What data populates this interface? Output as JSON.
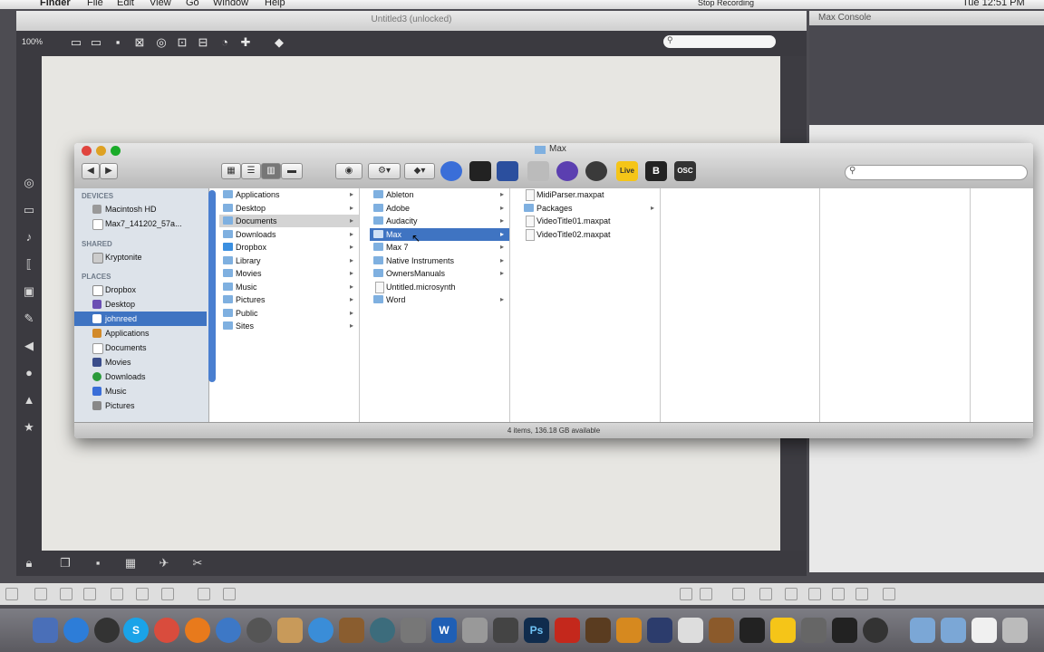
{
  "menubar": {
    "app_name": "Finder",
    "items": [
      "File",
      "Edit",
      "View",
      "Go",
      "Window",
      "Help"
    ],
    "recording": "Stop Recording",
    "clock": "Tue 12:51 PM"
  },
  "max_editor": {
    "title": "Untitled3 (unlocked)",
    "zoom": "100%"
  },
  "console": {
    "title": "Max Console"
  },
  "finder": {
    "title": "Max",
    "sidebar": {
      "devices_header": "DEVICES",
      "devices": [
        "Macintosh HD",
        "Max7_141202_57a..."
      ],
      "shared_header": "SHARED",
      "shared": [
        "Kryptonite"
      ],
      "places_header": "PLACES",
      "places": [
        "Dropbox",
        "Desktop",
        "johnreed",
        "Applications",
        "Documents",
        "Movies",
        "Downloads",
        "Music",
        "Pictures"
      ]
    },
    "column1": [
      "Applications",
      "Desktop",
      "Documents",
      "Downloads",
      "Dropbox",
      "Library",
      "Movies",
      "Music",
      "Pictures",
      "Public",
      "Sites"
    ],
    "column2": [
      "Ableton",
      "Adobe",
      "Audacity",
      "Max",
      "Max 7",
      "Native Instruments",
      "OwnersManuals",
      "Untitled.microsynth",
      "Word"
    ],
    "column3": [
      "MidiParser.maxpat",
      "Packages",
      "VideoTitle01.maxpat",
      "VideoTitle02.maxpat"
    ],
    "status": "4 items, 136.18 GB available",
    "toolbar_labels": {
      "b_app": "B",
      "osc_app": "OSC",
      "live_app": "Live"
    }
  },
  "dock": {
    "labels": [
      "S",
      "Ps",
      "W"
    ]
  }
}
